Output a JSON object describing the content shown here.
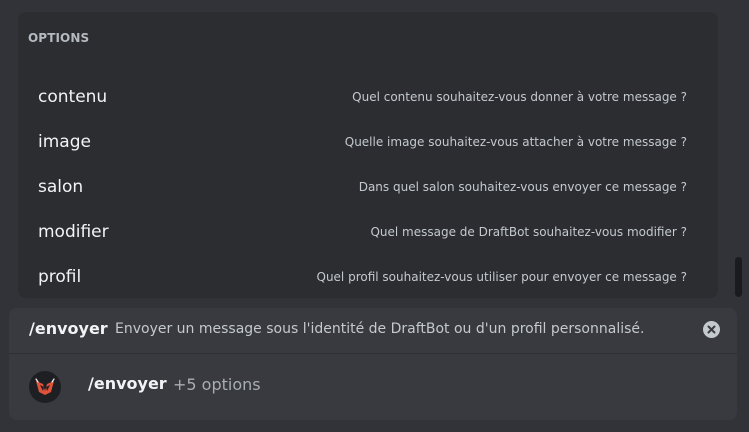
{
  "options_panel": {
    "header": "OPTIONS",
    "items": [
      {
        "name": "contenu",
        "description": "Quel contenu souhaitez-vous donner à votre message ?"
      },
      {
        "name": "image",
        "description": "Quelle image souhaitez-vous attacher à votre message ?"
      },
      {
        "name": "salon",
        "description": "Dans quel salon souhaitez-vous envoyer ce message ?"
      },
      {
        "name": "modifier",
        "description": "Quel message de DraftBot souhaitez-vous modifier ?"
      },
      {
        "name": "profil",
        "description": "Quel profil souhaitez-vous utiliser pour envoyer ce message ?"
      }
    ]
  },
  "command": {
    "name": "/envoyer",
    "description": "Envoyer un message sous l'identité de DraftBot ou d'un profil personnalisé.",
    "clear_icon": "close-circle-icon",
    "bot_avatar_icon": "draftbot-logo-icon",
    "extra_options": "+5 options"
  },
  "colors": {
    "background": "#313338",
    "panel": "#2b2d31",
    "command_box": "#383a40",
    "text_primary": "#f2f3f5",
    "text_muted": "#c4c9ce",
    "bot_logo_red": "#e0533a"
  }
}
